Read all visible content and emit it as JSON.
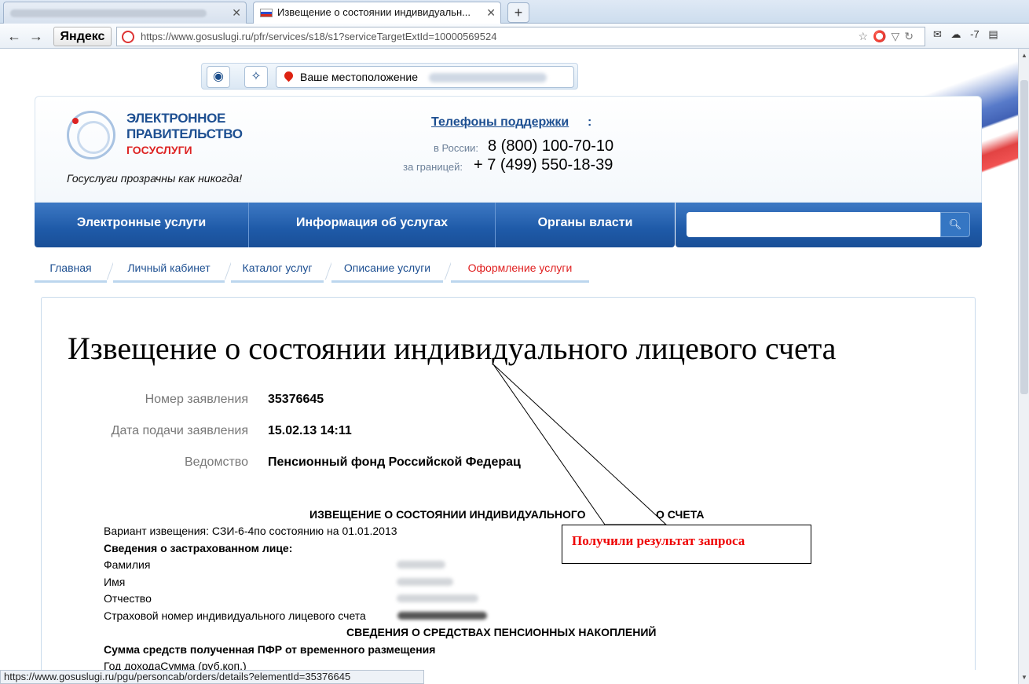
{
  "browser": {
    "inactive_tab_title": "",
    "active_tab_title": "Извещение о состоянии индивидуального лицевого счета",
    "active_tab_display": "Извещение о состоянии индивидуальн...",
    "tab_close": "✕",
    "new_tab": "+",
    "yandex_label": "Яндекс",
    "url": "https://www.gosuslugi.ru/pfr/services/s18/s1?serviceTargetExtId=10000569524",
    "weather": "-7",
    "status_url": "https://www.gosuslugi.ru/pgu/personcab/orders/details?elementId=35376645"
  },
  "toolbar": {
    "location_label": "Ваше местоположение",
    "vision_icon": "eye-icon",
    "compass_icon": "compass-icon"
  },
  "header": {
    "logo_line1": "ЭЛЕКТРОННОЕ",
    "logo_line2": "ПРАВИТЕЛЬСТВО",
    "logo_line3": "ГОСУСЛУГИ",
    "slogan": "Госуслуги прозрачны как никогда!",
    "phones_title": "Телефоны поддержки",
    "phones_colon": ":",
    "phone1_label": "в России:",
    "phone1": "8 (800) 100-70-10",
    "phone2_label": "за границей:",
    "phone2": "+ 7 (499) 550-18-39"
  },
  "menu": {
    "items": [
      {
        "label": "Электронные услуги"
      },
      {
        "label": "Информация об услугах"
      },
      {
        "label": "Органы власти"
      }
    ],
    "search_placeholder": ""
  },
  "breadcrumbs": [
    {
      "label": "Главная"
    },
    {
      "label": "Личный кабинет"
    },
    {
      "label": "Каталог услуг"
    },
    {
      "label": "Описание услуги"
    },
    {
      "label": "Оформление услуги"
    }
  ],
  "main": {
    "title": "Извещение о состоянии индивидуального лицевого счета",
    "fields": [
      {
        "label": "Номер заявления",
        "value": "35376645"
      },
      {
        "label": "Дата подачи заявления",
        "value": "15.02.13 14:11"
      },
      {
        "label": "Ведомство",
        "value": "Пенсионный фонд Российской Федерац"
      }
    ],
    "doc": {
      "heading": "ИЗВЕЩЕНИЕ О СОСТОЯНИИ ИНДИВИДУАЛЬНОГО",
      "heading_tail": "О СЧЕТА",
      "variant": "Вариант извещения: СЗИ-6-4по состоянию на 01.01.2013",
      "insured_heading": "Сведения о застрахованном лице:",
      "surname_label": "Фамилия",
      "name_label": "Имя",
      "patronymic_label": "Отчество",
      "snils_label": "Страховой номер индивидуального лицевого счета",
      "funds_heading": "СВЕДЕНИЯ О СРЕДСТВАХ ПЕНСИОННЫХ НАКОПЛЕНИЙ",
      "funds_sum": "Сумма средств полученная ПФР от временного размещения",
      "income_year": "Год доходаСумма (руб.коп.)"
    }
  },
  "annotation": {
    "callout_text": "Получили результат запроса"
  }
}
